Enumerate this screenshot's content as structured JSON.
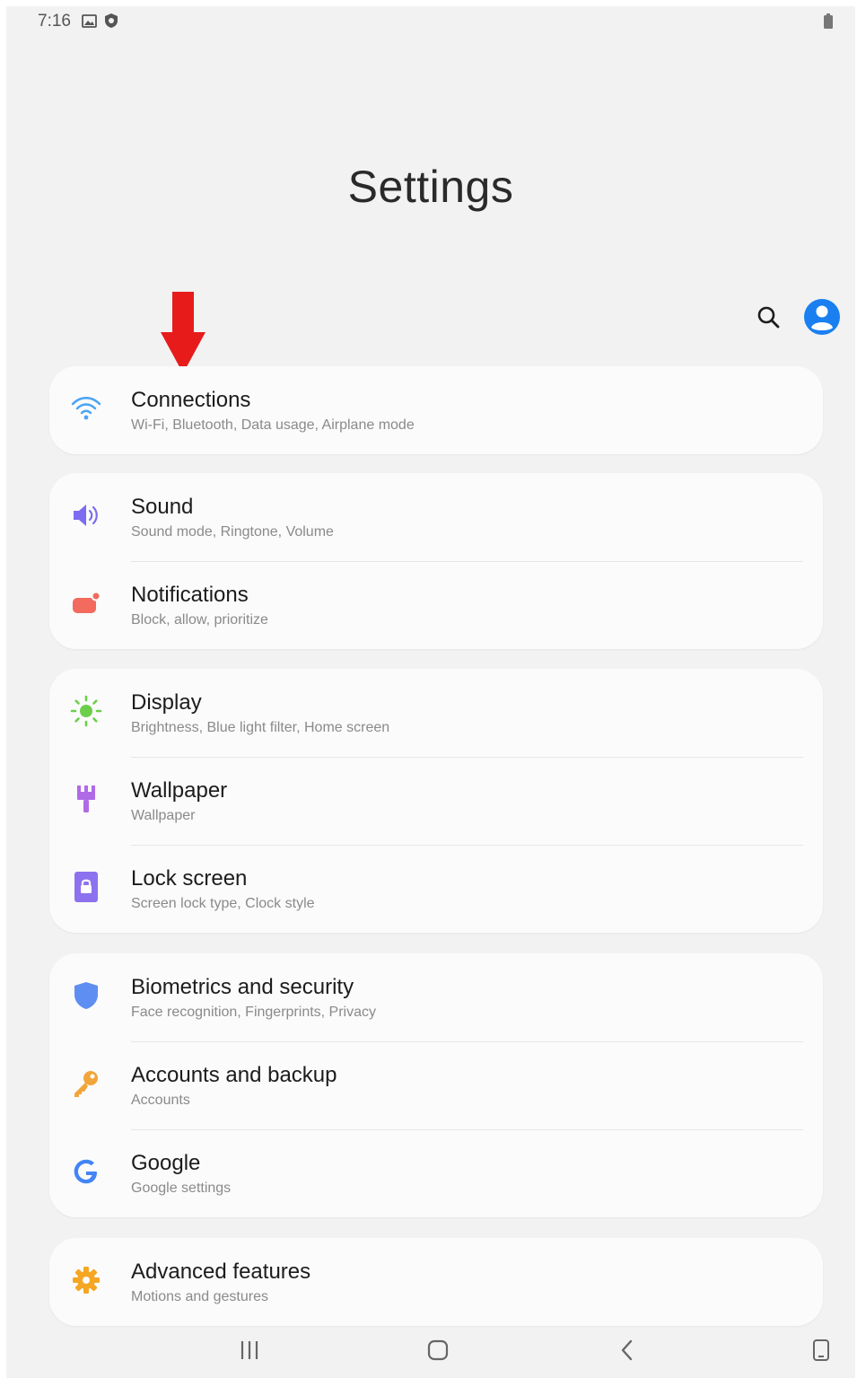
{
  "status_bar": {
    "time": "7:16"
  },
  "header": {
    "title": "Settings"
  },
  "groups": [
    {
      "items": [
        {
          "key": "connections",
          "title": "Connections",
          "subtitle": "Wi-Fi, Bluetooth, Data usage, Airplane mode",
          "icon": "wifi-icon",
          "color": "#4aa3f5"
        }
      ]
    },
    {
      "items": [
        {
          "key": "sound",
          "title": "Sound",
          "subtitle": "Sound mode, Ringtone, Volume",
          "icon": "speaker-icon",
          "color": "#7b6cf0"
        },
        {
          "key": "notifications",
          "title": "Notifications",
          "subtitle": "Block, allow, prioritize",
          "icon": "notification-icon",
          "color": "#f26b5e"
        }
      ]
    },
    {
      "items": [
        {
          "key": "display",
          "title": "Display",
          "subtitle": "Brightness, Blue light filter, Home screen",
          "icon": "sun-icon",
          "color": "#6ccf4a"
        },
        {
          "key": "wallpaper",
          "title": "Wallpaper",
          "subtitle": "Wallpaper",
          "icon": "brush-icon",
          "color": "#b06ae6"
        },
        {
          "key": "lock-screen",
          "title": "Lock screen",
          "subtitle": "Screen lock type, Clock style",
          "icon": "lock-icon",
          "color": "#8c72ee"
        }
      ]
    },
    {
      "items": [
        {
          "key": "biometrics",
          "title": "Biometrics and security",
          "subtitle": "Face recognition, Fingerprints, Privacy",
          "icon": "shield-icon",
          "color": "#5f8ef2"
        },
        {
          "key": "accounts",
          "title": "Accounts and backup",
          "subtitle": "Accounts",
          "icon": "key-icon",
          "color": "#f2a53a"
        },
        {
          "key": "google",
          "title": "Google",
          "subtitle": "Google settings",
          "icon": "google-icon",
          "color": "#4285f4"
        }
      ]
    },
    {
      "items": [
        {
          "key": "advanced",
          "title": "Advanced features",
          "subtitle": "Motions and gestures",
          "icon": "gear-icon",
          "color": "#f5a623"
        }
      ]
    }
  ],
  "colors": {
    "accent": "#1a7ff0",
    "annotation_arrow": "#e81b1b"
  }
}
